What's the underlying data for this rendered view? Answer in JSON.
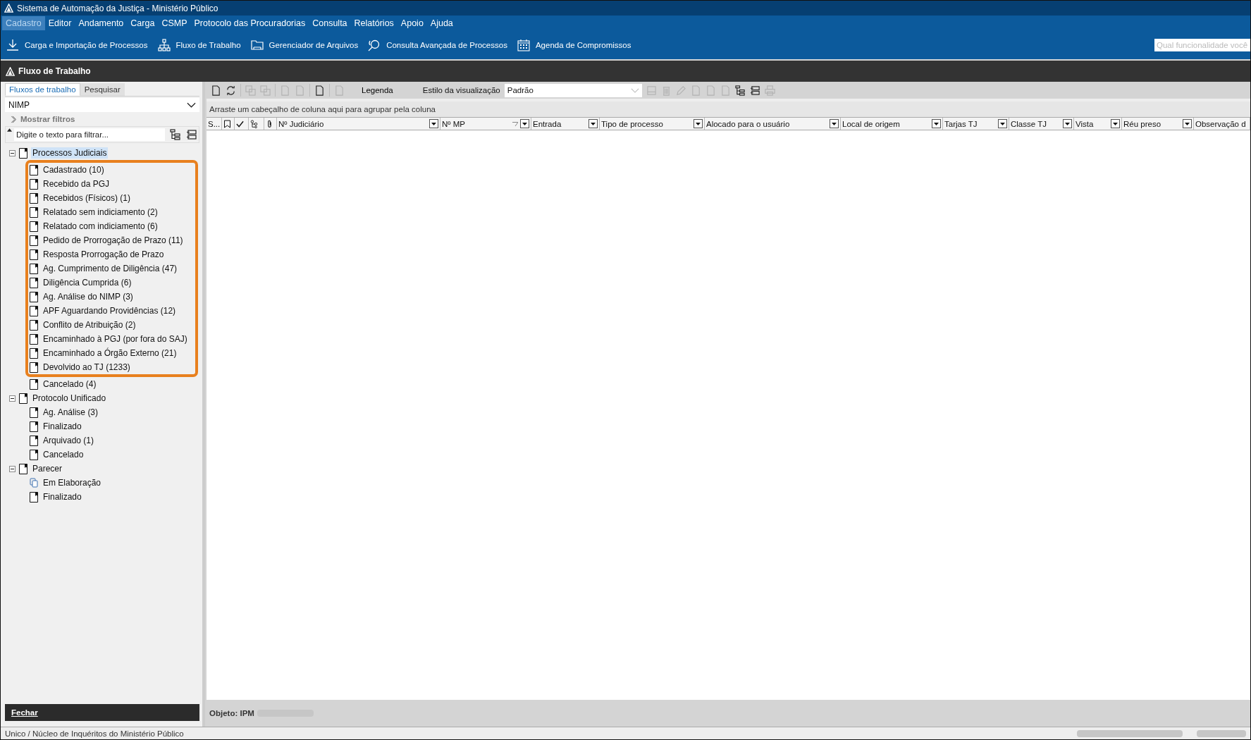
{
  "window": {
    "title": "Sistema de Automação da Justiça - Ministério Público"
  },
  "menu": [
    {
      "label": "Cadastro",
      "selected": true
    },
    {
      "label": "Editor",
      "selected": false
    },
    {
      "label": "Andamento",
      "selected": false
    },
    {
      "label": "Carga",
      "selected": false
    },
    {
      "label": "CSMP",
      "selected": false
    },
    {
      "label": "Protocolo das Procuradorias",
      "selected": false
    },
    {
      "label": "Consulta",
      "selected": false
    },
    {
      "label": "Relatórios",
      "selected": false
    },
    {
      "label": "Apoio",
      "selected": false
    },
    {
      "label": "Ajuda",
      "selected": false
    }
  ],
  "shortcuts": [
    {
      "label": "Carga e Importação de Processos",
      "kind": "download"
    },
    {
      "label": "Fluxo de Trabalho",
      "kind": "hierarchy"
    },
    {
      "label": "Gerenciador de Arquivos",
      "kind": "folder"
    },
    {
      "label": "Consulta Avançada de Processos",
      "kind": "search"
    },
    {
      "label": "Agenda de Compromissos",
      "kind": "calendar"
    }
  ],
  "search": {
    "placeholder": "Qual funcionalidade você"
  },
  "section_title": "Fluxo de Trabalho",
  "left_tabs": [
    {
      "label": "Fluxos de trabalho",
      "selected": true
    },
    {
      "label": "Pesquisar",
      "selected": false
    }
  ],
  "flow_select": {
    "value": "NIMP"
  },
  "show_filters": "Mostrar filtros",
  "filter": {
    "placeholder": "Digite o texto para filtrar..."
  },
  "tree": [
    {
      "label": "Processos Judiciais",
      "selected": true,
      "expanded": true,
      "highlighted_children": [
        {
          "label": "Cadastrado (10)",
          "kind": "document"
        },
        {
          "label": "Recebido da PGJ",
          "kind": "document"
        },
        {
          "label": "Recebidos (Físicos) (1)",
          "kind": "document"
        },
        {
          "label": "Relatado sem indiciamento (2)",
          "kind": "document"
        },
        {
          "label": "Relatado com indiciamento (6)",
          "kind": "document"
        },
        {
          "label": "Pedido de Prorrogação de Prazo (11)",
          "kind": "document"
        },
        {
          "label": "Resposta Prorrogação de Prazo",
          "kind": "document"
        },
        {
          "label": "Ag. Cumprimento de Diligência (47)",
          "kind": "document"
        },
        {
          "label": "Diligência Cumprida (6)",
          "kind": "document"
        },
        {
          "label": "Ag. Análise do NIMP (3)",
          "kind": "document"
        },
        {
          "label": "APF Aguardando Providências (12)",
          "kind": "document"
        },
        {
          "label": "Conflito de Atribuição (2)",
          "kind": "document"
        },
        {
          "label": "Encaminhado à PGJ (por fora do SAJ)",
          "kind": "document"
        },
        {
          "label": "Encaminhado a Órgão Externo (21)",
          "kind": "document"
        },
        {
          "label": "Devolvido ao TJ (1233)",
          "kind": "document"
        }
      ],
      "children": [
        {
          "label": "Cancelado (4)",
          "kind": "document"
        }
      ]
    },
    {
      "label": "Protocolo Unificado",
      "selected": false,
      "expanded": true,
      "children": [
        {
          "label": "Ag. Análise (3)",
          "kind": "document"
        },
        {
          "label": "Finalizado",
          "kind": "document"
        },
        {
          "label": "Arquivado (1)",
          "kind": "document"
        },
        {
          "label": "Cancelado",
          "kind": "document"
        }
      ]
    },
    {
      "label": "Parecer",
      "selected": false,
      "expanded": true,
      "children": [
        {
          "label": "Em Elaboração",
          "kind": "copies"
        },
        {
          "label": "Finalizado",
          "kind": "document"
        }
      ]
    }
  ],
  "close_button": "Fechar",
  "toolbar": {
    "legend": "Legenda",
    "style_label": "Estilo da visualização",
    "style_value": "Padrão",
    "button_groups": [
      [
        {
          "kind": "page",
          "disabled": false
        },
        {
          "kind": "refresh",
          "disabled": false
        }
      ],
      [
        {
          "kind": "copy",
          "disabled": true
        },
        {
          "kind": "copy",
          "disabled": true
        }
      ],
      [
        {
          "kind": "page",
          "disabled": true
        },
        {
          "kind": "page",
          "disabled": true
        }
      ],
      [
        {
          "kind": "page",
          "disabled": false
        }
      ],
      [
        {
          "kind": "page",
          "disabled": true
        }
      ]
    ],
    "right_buttons": [
      {
        "kind": "save",
        "disabled": true
      },
      {
        "kind": "trash",
        "disabled": true
      },
      {
        "kind": "pencil",
        "disabled": true
      },
      {
        "kind": "page",
        "disabled": true
      },
      {
        "kind": "page",
        "disabled": true
      },
      {
        "kind": "page",
        "disabled": true
      },
      {
        "kind": "tree",
        "disabled": false
      },
      {
        "kind": "collapse",
        "disabled": false
      },
      {
        "kind": "print",
        "disabled": true
      }
    ]
  },
  "group_hint": "Arraste um cabeçalho de coluna aqui para agrupar pela coluna",
  "columns": [
    {
      "kind": "text",
      "label": "S..."
    },
    {
      "kind": "bookmark"
    },
    {
      "kind": "check"
    },
    {
      "kind": "tree"
    },
    {
      "kind": "clip"
    },
    {
      "kind": "filter",
      "label": "Nº Judiciário",
      "filtered": false
    },
    {
      "kind": "filter",
      "label": "Nº MP",
      "filtered": true
    },
    {
      "kind": "filter",
      "label": "Entrada",
      "filtered": false
    },
    {
      "kind": "filter",
      "label": "Tipo de processo",
      "filtered": false
    },
    {
      "kind": "filter",
      "label": "Alocado para o usuário",
      "filtered": false
    },
    {
      "kind": "filter",
      "label": "Local de origem",
      "filtered": false
    },
    {
      "kind": "filter",
      "label": "Tarjas TJ",
      "filtered": false
    },
    {
      "kind": "filter",
      "label": "Classe TJ",
      "filtered": false
    },
    {
      "kind": "filter",
      "label": "Vista",
      "filtered": false
    },
    {
      "kind": "filter",
      "label": "Réu preso",
      "filtered": false
    },
    {
      "kind": "filter",
      "label": "Observação d"
    }
  ],
  "object_label": "Objeto: IPM",
  "status_bar": "Unico / Núcleo de Inquéritos do Ministério Público"
}
